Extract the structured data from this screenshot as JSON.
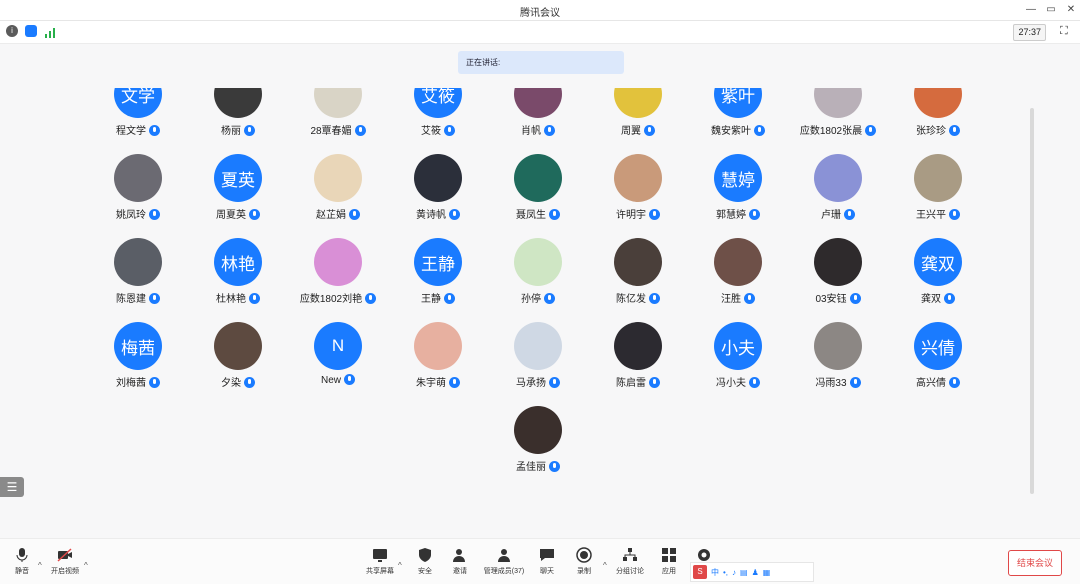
{
  "window": {
    "title": "腾讯会议"
  },
  "infobar": {
    "timer": "27:37"
  },
  "speaking": {
    "label": "正在讲话:"
  },
  "participants": [
    {
      "name": "程文学",
      "avatar_text": "文学",
      "avatar_type": "text",
      "row": 0,
      "col": 0
    },
    {
      "name": "杨丽",
      "avatar_text": "",
      "avatar_type": "photo",
      "color": "#3a3a3a",
      "row": 0,
      "col": 1
    },
    {
      "name": "28覃春媚",
      "avatar_text": "",
      "avatar_type": "photo",
      "color": "#d9d4c6",
      "row": 0,
      "col": 2
    },
    {
      "name": "艾筱",
      "avatar_text": "艾筱",
      "avatar_type": "text",
      "row": 0,
      "col": 3
    },
    {
      "name": "肖帆",
      "avatar_text": "",
      "avatar_type": "photo",
      "color": "#7a4a6a",
      "row": 0,
      "col": 4
    },
    {
      "name": "周翼",
      "avatar_text": "",
      "avatar_type": "photo",
      "color": "#e2c23c",
      "row": 0,
      "col": 5
    },
    {
      "name": "魏安紫叶",
      "avatar_text": "紫叶",
      "avatar_type": "text",
      "row": 0,
      "col": 6
    },
    {
      "name": "应数1802张晨",
      "avatar_text": "",
      "avatar_type": "photo",
      "color": "#b9b0b8",
      "row": 0,
      "col": 7
    },
    {
      "name": "张珍珍",
      "avatar_text": "",
      "avatar_type": "photo",
      "color": "#d56b3e",
      "row": 0,
      "col": 8
    },
    {
      "name": "姚凤玲",
      "avatar_text": "",
      "avatar_type": "photo",
      "color": "#6b6a72",
      "row": 1,
      "col": 0
    },
    {
      "name": "周夏英",
      "avatar_text": "夏英",
      "avatar_type": "text",
      "row": 1,
      "col": 1
    },
    {
      "name": "赵芷娟",
      "avatar_text": "",
      "avatar_type": "photo",
      "color": "#e9d6b8",
      "row": 1,
      "col": 2
    },
    {
      "name": "黄诗帆",
      "avatar_text": "",
      "avatar_type": "photo",
      "color": "#2b2f3a",
      "row": 1,
      "col": 3
    },
    {
      "name": "聂凤生",
      "avatar_text": "",
      "avatar_type": "photo",
      "color": "#1f6a5c",
      "row": 1,
      "col": 4
    },
    {
      "name": "许明宇",
      "avatar_text": "",
      "avatar_type": "photo",
      "color": "#c99a7a",
      "row": 1,
      "col": 5
    },
    {
      "name": "郭慧婷",
      "avatar_text": "慧婷",
      "avatar_type": "text",
      "row": 1,
      "col": 6
    },
    {
      "name": "卢珊",
      "avatar_text": "",
      "avatar_type": "photo",
      "color": "#8a92d6",
      "row": 1,
      "col": 7
    },
    {
      "name": "王兴平",
      "avatar_text": "",
      "avatar_type": "photo",
      "color": "#a99b84",
      "row": 1,
      "col": 8
    },
    {
      "name": "陈恩建",
      "avatar_text": "",
      "avatar_type": "photo",
      "color": "#5a5e66",
      "row": 2,
      "col": 0
    },
    {
      "name": "杜林艳",
      "avatar_text": "林艳",
      "avatar_type": "text",
      "row": 2,
      "col": 1
    },
    {
      "name": "应数1802刘艳",
      "avatar_text": "",
      "avatar_type": "photo",
      "color": "#d98fd6",
      "row": 2,
      "col": 2
    },
    {
      "name": "王静",
      "avatar_text": "王静",
      "avatar_type": "text",
      "row": 2,
      "col": 3
    },
    {
      "name": "孙停",
      "avatar_text": "",
      "avatar_type": "photo",
      "color": "#cfe6c4",
      "row": 2,
      "col": 4
    },
    {
      "name": "陈亿发",
      "avatar_text": "",
      "avatar_type": "photo",
      "color": "#4a3f3a",
      "row": 2,
      "col": 5
    },
    {
      "name": "汪胜",
      "avatar_text": "",
      "avatar_type": "photo",
      "color": "#6e5048",
      "row": 2,
      "col": 6
    },
    {
      "name": "03安钰",
      "avatar_text": "",
      "avatar_type": "photo",
      "color": "#2e2a2c",
      "row": 2,
      "col": 7
    },
    {
      "name": "龚双",
      "avatar_text": "龚双",
      "avatar_type": "text",
      "row": 2,
      "col": 8
    },
    {
      "name": "刘梅茜",
      "avatar_text": "梅茜",
      "avatar_type": "text",
      "row": 3,
      "col": 0
    },
    {
      "name": "夕染",
      "avatar_text": "",
      "avatar_type": "photo",
      "color": "#5d4a40",
      "row": 3,
      "col": 1
    },
    {
      "name": "New",
      "avatar_text": "N",
      "avatar_type": "text",
      "row": 3,
      "col": 2
    },
    {
      "name": "朱宇萌",
      "avatar_text": "",
      "avatar_type": "photo",
      "color": "#e7b0a0",
      "row": 3,
      "col": 3
    },
    {
      "name": "马承扬",
      "avatar_text": "",
      "avatar_type": "photo",
      "color": "#cfd8e4",
      "row": 3,
      "col": 4
    },
    {
      "name": "陈启雷",
      "avatar_text": "",
      "avatar_type": "photo",
      "color": "#2c2a30",
      "row": 3,
      "col": 5
    },
    {
      "name": "冯小夫",
      "avatar_text": "小夫",
      "avatar_type": "text",
      "row": 3,
      "col": 6
    },
    {
      "name": "冯雨33",
      "avatar_text": "",
      "avatar_type": "photo",
      "color": "#8c8784",
      "row": 3,
      "col": 7
    },
    {
      "name": "高兴倩",
      "avatar_text": "兴倩",
      "avatar_type": "text",
      "row": 3,
      "col": 8
    },
    {
      "name": "孟佳丽",
      "avatar_text": "",
      "avatar_type": "photo",
      "color": "#3a2f2c",
      "row": 4,
      "col": 4
    }
  ],
  "toolbar": {
    "mute": "静音",
    "video": "开启视频",
    "share": "共享屏幕",
    "security": "安全",
    "invite": "邀请",
    "members": "管理成员(37)",
    "chat": "聊天",
    "record": "录制",
    "breakout": "分组讨论",
    "apps": "应用",
    "end": "结束会议"
  },
  "ime": {
    "label": "中"
  },
  "colors": {
    "accent": "#1a7bff",
    "danger": "#e04848",
    "speaking_bg": "#dce8fb"
  }
}
